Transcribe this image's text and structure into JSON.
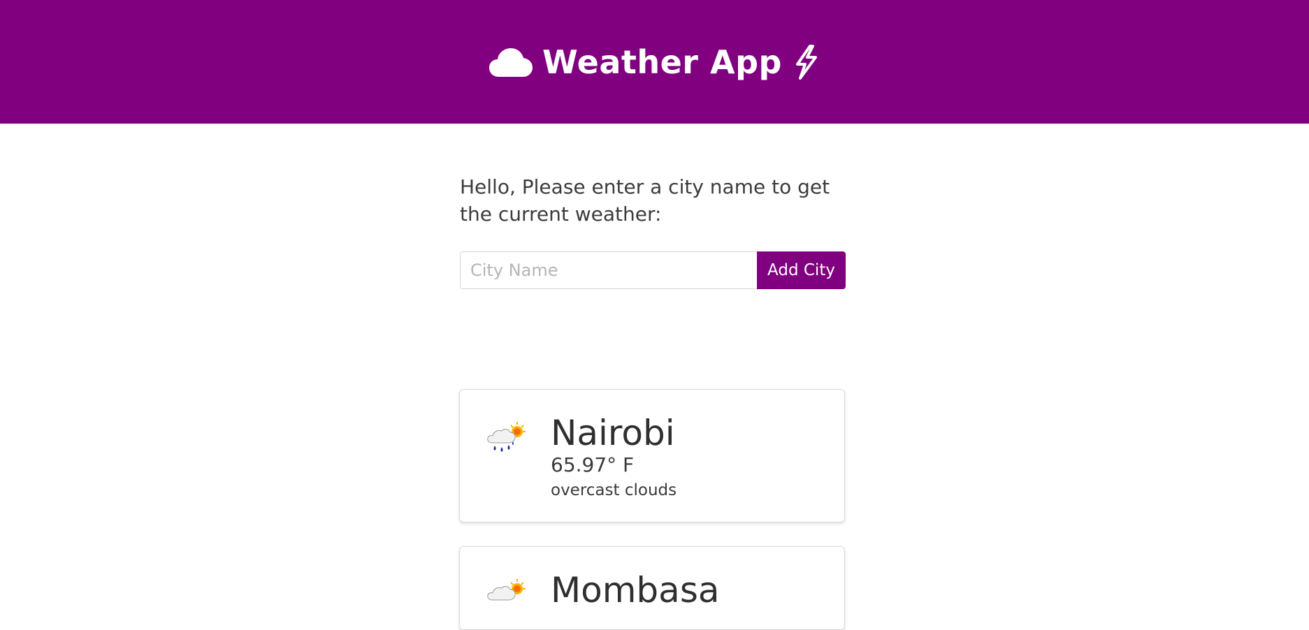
{
  "header": {
    "title": "Weather App",
    "left_icon": "cloud-icon",
    "right_icon": "lightning-icon",
    "background": "#800080"
  },
  "prompt": {
    "text": "Hello, Please enter a city name to get the current weather:"
  },
  "search": {
    "placeholder": "City Name",
    "value": "",
    "button_label": "Add City"
  },
  "cities": [
    {
      "name": "Nairobi",
      "temperature": "65.97° F",
      "description": "overcast clouds",
      "icon": "rain-sun-cloud-icon"
    },
    {
      "name": "Mombasa",
      "icon": "sun-cloud-icon"
    }
  ]
}
